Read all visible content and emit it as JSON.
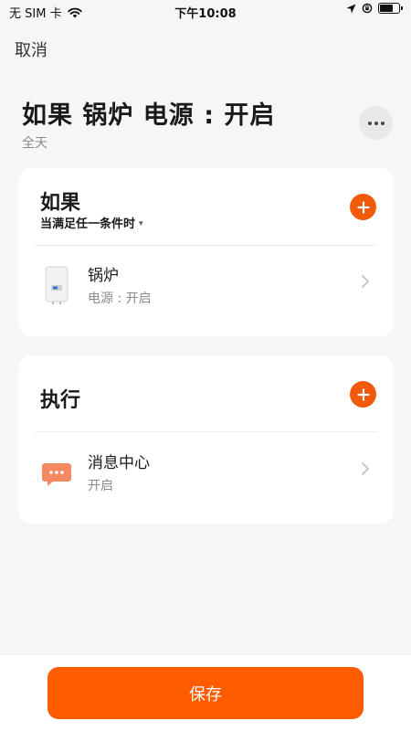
{
  "status_bar": {
    "carrier": "无 SIM 卡",
    "time": "下午10:08"
  },
  "nav": {
    "cancel_label": "取消"
  },
  "header": {
    "title": "如果 锅炉 电源 : 开启",
    "subtitle": "全天"
  },
  "if_section": {
    "title": "如果",
    "condition_mode": "当满足任一条件时",
    "items": [
      {
        "name": "锅炉",
        "detail": "电源 : 开启",
        "icon": "boiler-icon"
      }
    ]
  },
  "do_section": {
    "title": "执行",
    "items": [
      {
        "name": "消息中心",
        "detail": "开启",
        "icon": "message-bubble-icon"
      }
    ]
  },
  "footer": {
    "save_label": "保存"
  },
  "colors": {
    "accent": "#f15a0b",
    "save_button": "#ff5c00",
    "message_icon": "#f38a62"
  }
}
